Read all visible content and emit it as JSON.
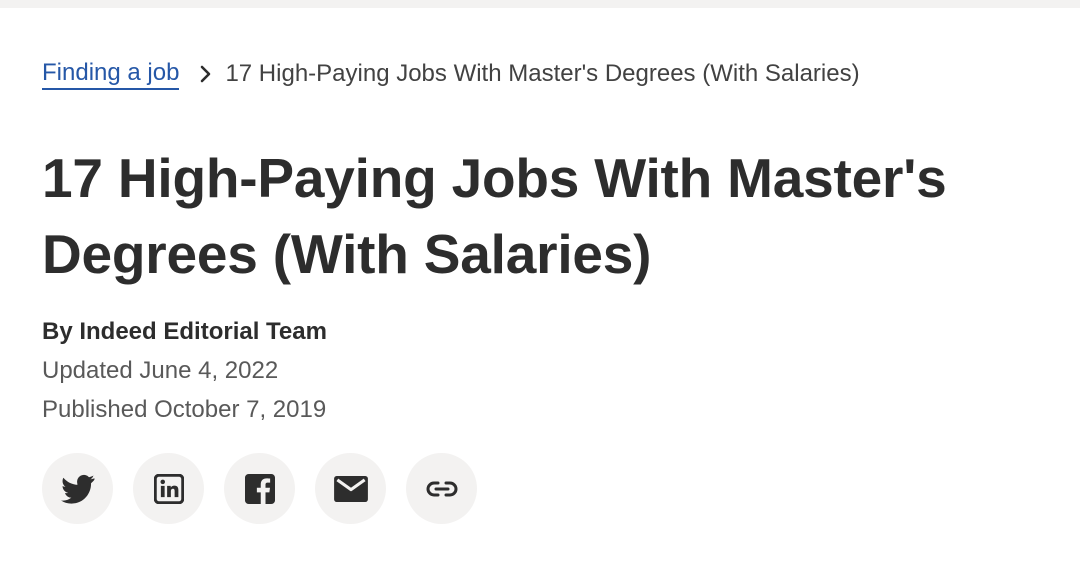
{
  "breadcrumb": {
    "parent_label": "Finding a job",
    "current_label": "17 High-Paying Jobs With Master's Degrees (With Salaries)"
  },
  "article": {
    "title": "17 High-Paying Jobs With Master's Degrees (With Salaries)",
    "author": "By Indeed Editorial Team",
    "updated": "Updated June 4, 2022",
    "published": "Published October 7, 2019"
  },
  "share": {
    "buttons": [
      {
        "icon": "twitter-icon"
      },
      {
        "icon": "linkedin-icon"
      },
      {
        "icon": "facebook-icon"
      },
      {
        "icon": "email-icon"
      },
      {
        "icon": "link-icon"
      }
    ]
  },
  "colors": {
    "link": "#2557a7",
    "text": "#2d2d2d",
    "muted": "#595959",
    "button_bg": "#f3f2f1"
  }
}
